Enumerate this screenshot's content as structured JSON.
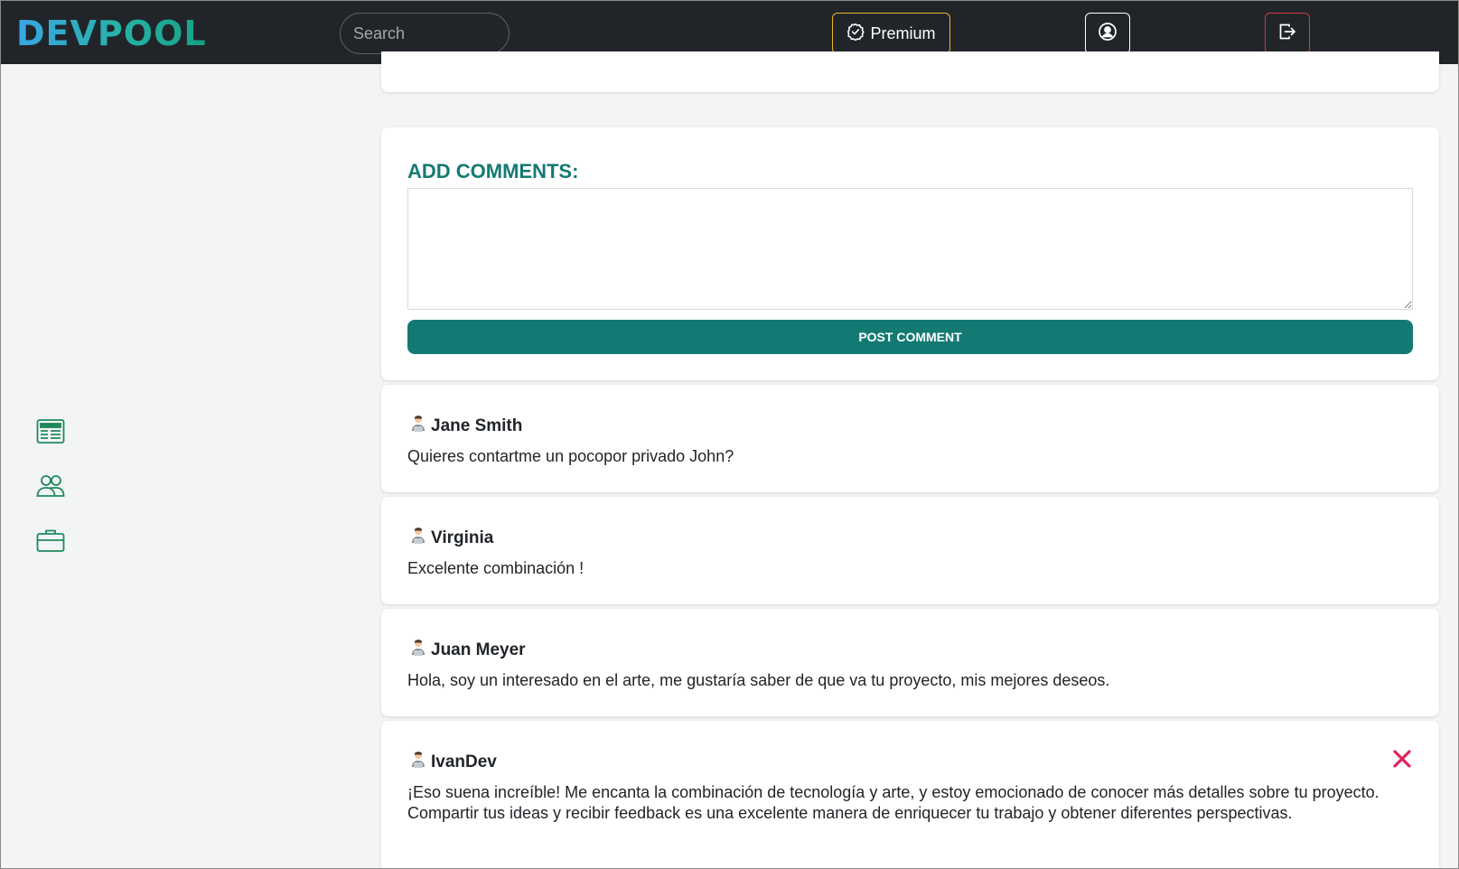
{
  "header": {
    "logo": "DEVPOOL",
    "search_placeholder": "Search",
    "premium_label": "Premium",
    "icons": {
      "premium": "check-circle-icon",
      "profile": "user-circle-icon",
      "logout": "logout-icon"
    }
  },
  "sidebar": {
    "items": [
      {
        "icon": "newspaper-icon"
      },
      {
        "icon": "users-icon"
      },
      {
        "icon": "briefcase-icon"
      }
    ]
  },
  "comment_form": {
    "title": "ADD COMMENTS:",
    "value": "",
    "button_label": "POST COMMENT"
  },
  "comments": [
    {
      "author": "Jane Smith",
      "text": "Quieres contartme un pocopor privado John?"
    },
    {
      "author": "Virginia",
      "text": "Excelente combinación !"
    },
    {
      "author": "Juan Meyer",
      "text": "Hola, soy un interesado en el arte, me gustaría saber de que va tu proyecto, mis mejores deseos."
    },
    {
      "author": "IvanDev",
      "text": "¡Eso suena increíble! Me encanta la combinación de tecnología y arte, y estoy emocionado de conocer más detalles sobre tu proyecto. Compartir tus ideas y recibir feedback es una excelente manera de enriquecer tu trabajo y obtener diferentes perspectivas.",
      "deletable": true
    }
  ],
  "colors": {
    "navbar": "#212529",
    "accent": "#137a73",
    "premium_border": "#f0b429",
    "danger": "#dc3545",
    "sidebar_icon": "#1e8a5a"
  }
}
